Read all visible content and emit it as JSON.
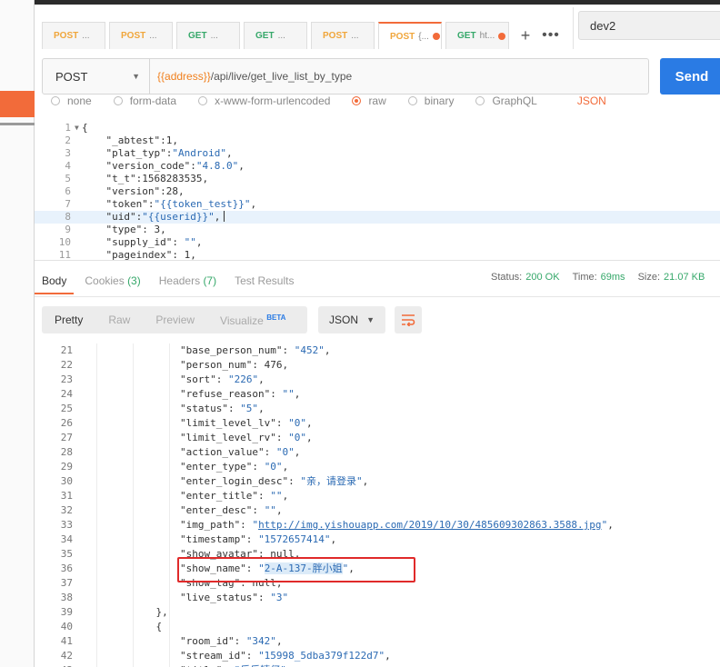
{
  "tabs": [
    {
      "method": "POST",
      "name": "...",
      "active": false,
      "dirty": false
    },
    {
      "method": "POST",
      "name": "...",
      "active": false,
      "dirty": false
    },
    {
      "method": "GET",
      "name": "...",
      "active": false,
      "dirty": false
    },
    {
      "method": "GET",
      "name": "...",
      "active": false,
      "dirty": false
    },
    {
      "method": "POST",
      "name": "...",
      "active": false,
      "dirty": false
    },
    {
      "method": "POST",
      "name": "{...",
      "active": true,
      "dirty": true
    },
    {
      "method": "GET",
      "name": "ht...",
      "active": false,
      "dirty": true
    }
  ],
  "tab_controls": {
    "plus": "+",
    "more": "•••"
  },
  "environment": "dev2",
  "request": {
    "method": "POST",
    "url_var": "{{address}}",
    "url_path": "/api/live/get_live_list_by_type",
    "send_label": "Send"
  },
  "body_types": [
    "none",
    "form-data",
    "x-www-form-urlencoded",
    "raw",
    "binary",
    "GraphQL",
    "JSON"
  ],
  "request_body": [
    {
      "n": "1",
      "text": "{",
      "fold": true
    },
    {
      "n": "2",
      "text": "    \"_abtest\":1,"
    },
    {
      "n": "3",
      "text": "    \"plat_typ\":\"Android\","
    },
    {
      "n": "4",
      "text": "    \"version_code\":\"4.8.0\","
    },
    {
      "n": "5",
      "text": "    \"t_t\":1568283535,"
    },
    {
      "n": "6",
      "text": "    \"version\":28,"
    },
    {
      "n": "7",
      "text": "    \"token\":\"{{token_test}}\","
    },
    {
      "n": "8",
      "text": "    \"uid\":\"{{userid}}\",",
      "highlight": true
    },
    {
      "n": "9",
      "text": "    \"type\": 3,"
    },
    {
      "n": "10",
      "text": "    \"supply_id\": \"\","
    },
    {
      "n": "11",
      "text": "    \"pageindex\": 1,"
    }
  ],
  "response_tabs": [
    {
      "label": "Body",
      "count": "",
      "active": true
    },
    {
      "label": "Cookies",
      "count": "(3)",
      "active": false
    },
    {
      "label": "Headers",
      "count": "(7)",
      "active": false
    },
    {
      "label": "Test Results",
      "count": "",
      "active": false
    }
  ],
  "response_status": {
    "status_label": "Status:",
    "status_value": "200 OK",
    "time_label": "Time:",
    "time_value": "69ms",
    "size_label": "Size:",
    "size_value": "21.07 KB"
  },
  "view_modes": [
    {
      "label": "Pretty",
      "active": true,
      "badge": ""
    },
    {
      "label": "Raw",
      "active": false,
      "badge": ""
    },
    {
      "label": "Preview",
      "active": false,
      "badge": ""
    },
    {
      "label": "Visualize",
      "active": false,
      "badge": "BETA"
    }
  ],
  "format": "JSON",
  "response_body": [
    {
      "n": "21",
      "text": "                \"base_person_num\": \"452\","
    },
    {
      "n": "22",
      "text": "                \"person_num\": 476,"
    },
    {
      "n": "23",
      "text": "                \"sort\": \"226\","
    },
    {
      "n": "24",
      "text": "                \"refuse_reason\": \"\","
    },
    {
      "n": "25",
      "text": "                \"status\": \"5\","
    },
    {
      "n": "26",
      "text": "                \"limit_level_lv\": \"0\","
    },
    {
      "n": "27",
      "text": "                \"limit_level_rv\": \"0\","
    },
    {
      "n": "28",
      "text": "                \"action_value\": \"0\","
    },
    {
      "n": "29",
      "text": "                \"enter_type\": \"0\","
    },
    {
      "n": "30",
      "text": "                \"enter_login_desc\": \"亲，请登录\","
    },
    {
      "n": "31",
      "text": "                \"enter_title\": \"\","
    },
    {
      "n": "32",
      "text": "                \"enter_desc\": \"\","
    },
    {
      "n": "33",
      "text": "                \"img_path\": \"http://img.yishouapp.com/2019/10/30/485609302863.3588.jpg\","
    },
    {
      "n": "34",
      "text": "                \"timestamp\": \"1572657414\","
    },
    {
      "n": "35",
      "text": "                \"show_avatar\": null,"
    },
    {
      "n": "36",
      "text": "                \"show_name\": \"2-A-137-胖小姐\","
    },
    {
      "n": "37",
      "text": "                \"show_tag\": null,"
    },
    {
      "n": "38",
      "text": "                \"live_status\": \"3\""
    },
    {
      "n": "39",
      "text": "            },"
    },
    {
      "n": "40",
      "text": "            {"
    },
    {
      "n": "41",
      "text": "                \"room_id\": \"342\","
    },
    {
      "n": "42",
      "text": "                \"stream_id\": \"15998_5dba379f122d7\","
    },
    {
      "n": "43",
      "text": "                \"title\": \"乐乐精仔\","
    }
  ],
  "colors": {
    "accent": "#f26b3a",
    "send": "#2a7be4",
    "ok": "#36a86a",
    "highlight_box": "#e02a2a"
  }
}
